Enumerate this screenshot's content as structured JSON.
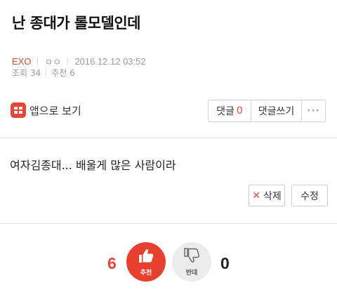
{
  "post": {
    "title": "난 종대가 롤모델인데",
    "category": "EXO",
    "author": "ㅇㅇ",
    "datetime": "2016.12.12 03:52",
    "views_label": "조회 34",
    "recommend_label": "추천 6",
    "body": "여자김종대... 배울게 많은 사람이라"
  },
  "toolbar": {
    "app_view_label": "앱으로 보기",
    "comments_label": "댓글",
    "comments_count": "0",
    "write_comment_label": "댓글쓰기",
    "more_label": "···"
  },
  "actions": {
    "delete_label": "삭제",
    "delete_icon": "✕",
    "edit_label": "수정"
  },
  "votes": {
    "up_count": "6",
    "up_label": "추천",
    "down_count": "0",
    "down_label": "반대"
  },
  "colors": {
    "accent": "#e5463a",
    "vote_up_bg": "#e8402f",
    "vote_down_bg": "#ececec"
  },
  "icons": {
    "app": "app-icon",
    "thumbs_up": "thumbs-up-icon",
    "thumbs_down": "thumbs-down-icon"
  }
}
